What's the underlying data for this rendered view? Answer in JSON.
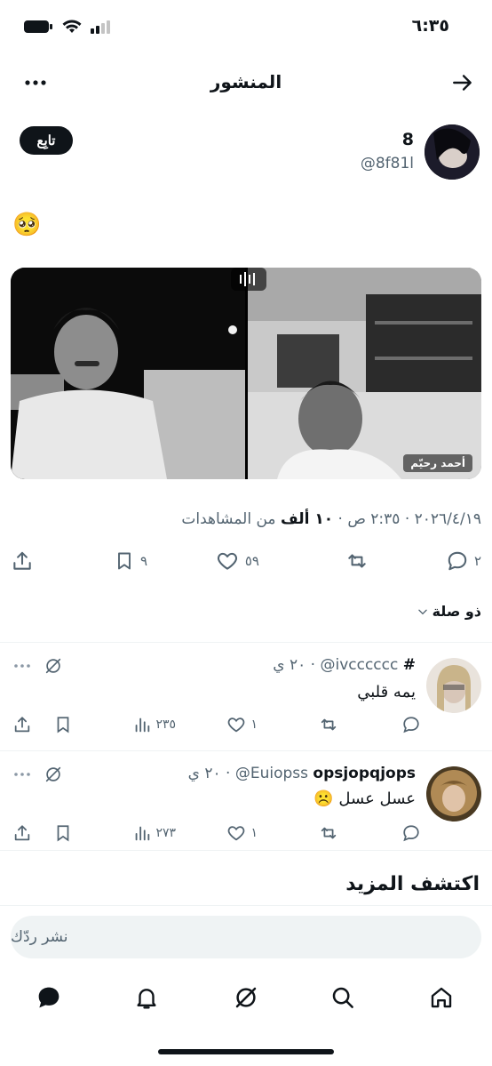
{
  "status_bar": {
    "time": "٦:٣٥"
  },
  "header": {
    "title": "المنشور"
  },
  "post": {
    "author_name": "8",
    "author_handle": "@8f81l",
    "follow_label": "تابِع",
    "text": "🥺",
    "video_name_tag": "أحمد رحيّم",
    "date": "٢٠٢٦/٤/١٩",
    "time": "٢:٣٥ ص",
    "views_count": "١٠ ألف",
    "views_label": "من المشاهدات",
    "replies": "٢",
    "likes": "٥٩",
    "bookmarks": "٩"
  },
  "related_label": "ذو صلة",
  "replies": [
    {
      "name": "#",
      "handle": "@ivcccccc",
      "time": "٢٠ ي",
      "text": "يمه قلبي",
      "emoji": "",
      "likes": "١",
      "views": "٢٣٥"
    },
    {
      "name": "opsjopqjops",
      "handle": "@Euiopss",
      "time": "٢٠ ي",
      "text": "عسل عسل",
      "emoji": "☹️",
      "likes": "١",
      "views": "٢٧٣"
    }
  ],
  "discover_title": "اكتشف المزيد",
  "reply_box": {
    "placeholder": "نشر ردّك"
  },
  "colors": {
    "text": "#0f1419",
    "secondary": "#536471",
    "divider": "#eff3f4"
  }
}
